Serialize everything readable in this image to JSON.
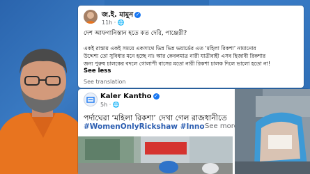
{
  "post": {
    "author": "জ.ই. মামুন",
    "time": "11h",
    "lines": [
      "দেশ আফগানিস্তান হতে কত দেরি, পাঞ্জেরী?",
      "একই রাস্তায় একই সময়ে একসাথে ভিন্ন ভিন্ন ভয়ার্ডের এত ‘মহিলা রিকশা’ নামানোর",
      "উদ্দেশ্য তো সুবিধার মনে হচ্ছে না। আর কেবলমাত্র নারী যাত্রীবাহী এসব হিজাবী রিকশার",
      "জন্য পুরুষ চালকের বদলে গোলাপী বাসের মতো নারী রিকশা চালক দিলে ভালো হতো না!"
    ],
    "see_less": "See less",
    "see_translation": "See translation"
  },
  "share": {
    "page_name": "Kaler Kantho",
    "time": "5h",
    "headline": "পর্দাঘেরা ‘মহিলা রিকশা’ দেখা গেল রাজধানীতে",
    "hashtags": "#WomenOnlyRickshaw #InnovativeTr...",
    "see_more": "See more"
  },
  "colors": {
    "facebook_blue": "#1877f2",
    "hashtag": "#2b5db0",
    "background": "#2f6fb7"
  }
}
